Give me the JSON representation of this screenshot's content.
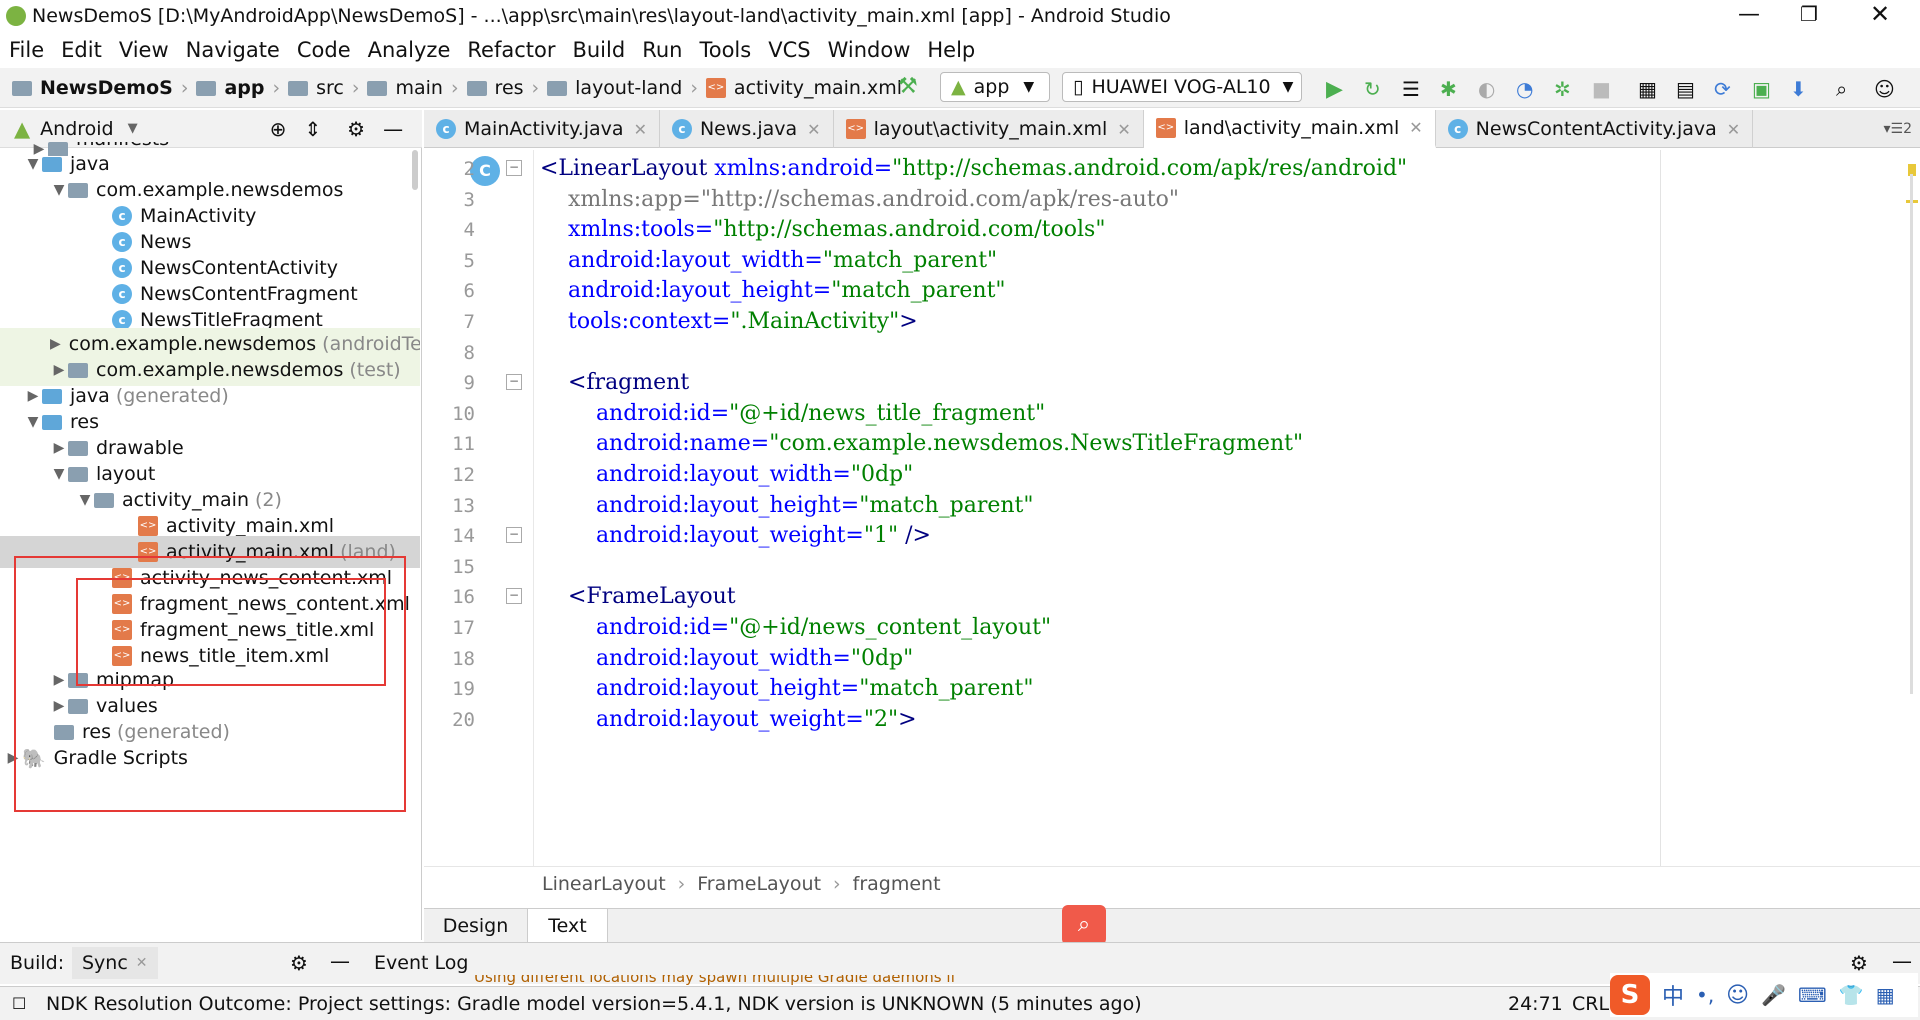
{
  "window": {
    "title": "NewsDemoS [D:\\MyAndroidApp\\NewsDemoS] - ...\\app\\src\\main\\res\\layout-land\\activity_main.xml [app] - Android Studio"
  },
  "menu": [
    "File",
    "Edit",
    "View",
    "Navigate",
    "Code",
    "Analyze",
    "Refactor",
    "Build",
    "Run",
    "Tools",
    "VCS",
    "Window",
    "Help"
  ],
  "nav": {
    "crumbs": [
      "NewsDemoS",
      "app",
      "src",
      "main",
      "res",
      "layout-land",
      "activity_main.xml"
    ],
    "config": "app",
    "device": "HUAWEI VOG-AL10"
  },
  "project": {
    "view": "Android",
    "tree": [
      {
        "label": "manifests",
        "extra": ""
      },
      {
        "label": "java",
        "extra": ""
      },
      {
        "label": "com.example.newsdemos",
        "extra": ""
      },
      {
        "label": "MainActivity",
        "extra": ""
      },
      {
        "label": "News",
        "extra": ""
      },
      {
        "label": "NewsContentActivity",
        "extra": ""
      },
      {
        "label": "NewsContentFragment",
        "extra": ""
      },
      {
        "label": "NewsTitleFragment",
        "extra": ""
      },
      {
        "label": "com.example.newsdemos",
        "extra": "(androidTe"
      },
      {
        "label": "com.example.newsdemos",
        "extra": "(test)"
      },
      {
        "label": "java",
        "extra": "(generated)"
      },
      {
        "label": "res",
        "extra": ""
      },
      {
        "label": "drawable",
        "extra": ""
      },
      {
        "label": "layout",
        "extra": ""
      },
      {
        "label": "activity_main",
        "extra": "(2)"
      },
      {
        "label": "activity_main.xml",
        "extra": ""
      },
      {
        "label": "activity_main.xml",
        "extra": "(land)"
      },
      {
        "label": "activity_news_content.xml",
        "extra": ""
      },
      {
        "label": "fragment_news_content.xml",
        "extra": ""
      },
      {
        "label": "fragment_news_title.xml",
        "extra": ""
      },
      {
        "label": "news_title_item.xml",
        "extra": ""
      },
      {
        "label": "mipmap",
        "extra": ""
      },
      {
        "label": "values",
        "extra": ""
      },
      {
        "label": "res",
        "extra": "(generated)"
      },
      {
        "label": "Gradle Scripts",
        "extra": ""
      }
    ]
  },
  "tabs": [
    {
      "label": "MainActivity.java"
    },
    {
      "label": "News.java"
    },
    {
      "label": "layout\\activity_main.xml"
    },
    {
      "label": "land\\activity_main.xml"
    },
    {
      "label": "NewsContentActivity.java"
    }
  ],
  "tab_overflow": "2",
  "code": {
    "line_numbers": [
      "2",
      "3",
      "4",
      "5",
      "6",
      "7",
      "8",
      "9",
      "10",
      "11",
      "12",
      "13",
      "14",
      "15",
      "16",
      "17",
      "18",
      "19",
      "20"
    ],
    "lines": [
      [
        [
          "tag",
          "<LinearLayout"
        ],
        [
          "attr",
          " xmlns:android="
        ],
        [
          "val",
          "\"http://schemas.android.com/apk/res/android\""
        ]
      ],
      [
        [
          "ns",
          "    xmlns:app=\"http://schemas.android.com/apk/res-auto\""
        ]
      ],
      [
        [
          "attr",
          "    xmlns:tools="
        ],
        [
          "val",
          "\"http://schemas.android.com/tools\""
        ]
      ],
      [
        [
          "attr",
          "    android:layout_width="
        ],
        [
          "val",
          "\"match_parent\""
        ]
      ],
      [
        [
          "attr",
          "    android:layout_height="
        ],
        [
          "val",
          "\"match_parent\""
        ]
      ],
      [
        [
          "attr",
          "    tools:context="
        ],
        [
          "val",
          "\".MainActivity\""
        ],
        [
          "tag",
          ">"
        ]
      ],
      [
        [
          "tag",
          ""
        ]
      ],
      [
        [
          "tag",
          "    <fragment"
        ]
      ],
      [
        [
          "attr",
          "        android:id="
        ],
        [
          "val",
          "\"@+id/news_title_fragment\""
        ]
      ],
      [
        [
          "attr",
          "        android:name="
        ],
        [
          "val",
          "\"com.example.newsdemos.NewsTitleFragment\""
        ]
      ],
      [
        [
          "attr",
          "        android:layout_width="
        ],
        [
          "val",
          "\"0dp\""
        ]
      ],
      [
        [
          "attr",
          "        android:layout_height="
        ],
        [
          "val",
          "\"match_parent\""
        ]
      ],
      [
        [
          "attr",
          "        android:layout_weight="
        ],
        [
          "val",
          "\"1\""
        ],
        [
          "tag",
          " />"
        ]
      ],
      [
        [
          "tag",
          ""
        ]
      ],
      [
        [
          "tag",
          "    <FrameLayout"
        ]
      ],
      [
        [
          "attr",
          "        android:id="
        ],
        [
          "val",
          "\"@+id/news_content_layout\""
        ]
      ],
      [
        [
          "attr",
          "        android:layout_width="
        ],
        [
          "val",
          "\"0dp\""
        ]
      ],
      [
        [
          "attr",
          "        android:layout_height="
        ],
        [
          "val",
          "\"match_parent\""
        ]
      ],
      [
        [
          "attr",
          "        android:layout_weight="
        ],
        [
          "val",
          "\"2\""
        ],
        [
          "tag",
          ">"
        ]
      ]
    ]
  },
  "breadcrumb": [
    "LinearLayout",
    "FrameLayout",
    "fragment"
  ],
  "editor_tabs": {
    "design": "Design",
    "text": "Text"
  },
  "build": {
    "label": "Build:",
    "sync": "Sync",
    "event_log": "Event Log",
    "notice": "Using different locations may spawn multiple Gradle daemons if"
  },
  "status": {
    "message": "NDK Resolution Outcome: Project settings: Gradle model version=5.4.1, NDK version is UNKNOWN (5 minutes ago)",
    "position": "24:71",
    "line_sep": "CRLF",
    "ime": "中"
  },
  "colors": {
    "accent": "#3d7bd6",
    "highlight": "#e53935",
    "run": "#4caf50"
  }
}
